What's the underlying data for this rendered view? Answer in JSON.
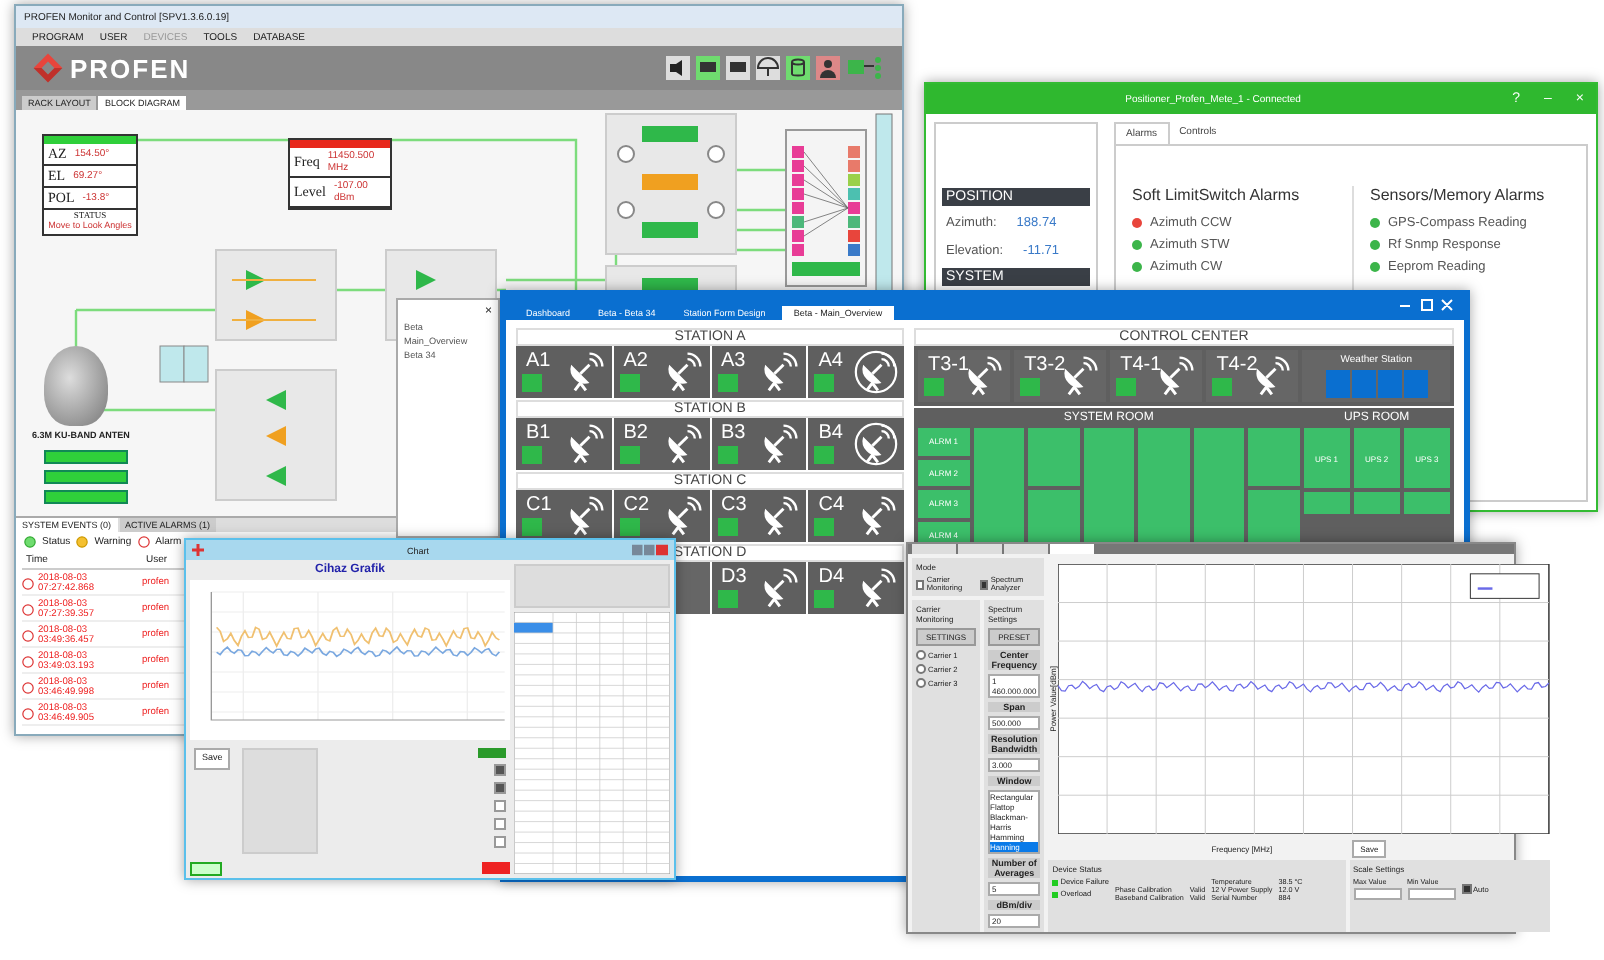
{
  "main_window": {
    "title": "PROFEN Monitor and Control [SPV1.3.6.0.19]",
    "menu": [
      {
        "label": "PROGRAM",
        "disabled": false
      },
      {
        "label": "USER",
        "disabled": false
      },
      {
        "label": "DEVICES",
        "disabled": true
      },
      {
        "label": "TOOLS",
        "disabled": false
      },
      {
        "label": "DATABASE",
        "disabled": false
      }
    ],
    "logo": "PROFEN",
    "tabs": [
      {
        "label": "RACK LAYOUT",
        "selected": false
      },
      {
        "label": "BLOCK DIAGRAM",
        "selected": true
      }
    ],
    "position_panel": {
      "rows": [
        {
          "label": "AZ",
          "value": "154.50°"
        },
        {
          "label": "EL",
          "value": "69.27°"
        },
        {
          "label": "POL",
          "value": "-13.8°"
        }
      ],
      "status_label": "STATUS",
      "status": "Move to Look Angles"
    },
    "receiver_panel": {
      "rows": [
        {
          "label": "Freq",
          "value": "11450.500 MHz"
        },
        {
          "label": "Level",
          "value": "-107.00 dBm"
        }
      ]
    },
    "antenna_label": "6.3M KU-BAND ANTEN",
    "events": {
      "tabs": [
        {
          "label": "SYSTEM EVENTS (0)",
          "selected": true
        },
        {
          "label": "ACTIVE ALARMS (1)",
          "selected": false
        }
      ],
      "legend": [
        "Status",
        "Warning",
        "Alarm"
      ],
      "columns": [
        "Time",
        "User"
      ],
      "rows": [
        {
          "time": "2018-08-03 07:27:42.868",
          "user": "profen"
        },
        {
          "time": "2018-08-03 07:27:39.357",
          "user": "profen"
        },
        {
          "time": "2018-08-03 03:49:36.457",
          "user": "profen"
        },
        {
          "time": "2018-08-03 03:49:03.193",
          "user": "profen"
        },
        {
          "time": "2018-08-03 03:46:49.998",
          "user": "profen"
        },
        {
          "time": "2018-08-03 03:46:49.905",
          "user": "profen"
        }
      ]
    }
  },
  "positioner_window": {
    "title": "Positioner_Profen_Mete_1 - Connected",
    "window_buttons": [
      "?",
      "–",
      "×"
    ],
    "position_heading": "POSITION",
    "readings": [
      {
        "label": "Azimuth:",
        "value": "188.74"
      },
      {
        "label": "Elevation:",
        "value": "-11.71"
      }
    ],
    "system_heading": "SYSTEM",
    "tabs": [
      {
        "label": "Alarms",
        "selected": true
      },
      {
        "label": "Controls",
        "selected": false
      }
    ],
    "alarm_groups": [
      {
        "title": "Soft LimitSwitch Alarms",
        "items": [
          {
            "label": "Azimuth CCW",
            "alarm": true
          },
          {
            "label": "Azimuth STW",
            "alarm": false
          },
          {
            "label": "Azimuth CW",
            "alarm": false
          }
        ]
      },
      {
        "title": "Sensors/Memory Alarms",
        "items": [
          {
            "label": "GPS-Compass Reading",
            "alarm": false
          },
          {
            "label": "Rf Snmp Response",
            "alarm": false
          },
          {
            "label": "Eeprom Reading",
            "alarm": false
          }
        ]
      }
    ]
  },
  "overview_window": {
    "close": "×",
    "tree": [
      "Beta",
      "Main_Overview",
      "Beta 34"
    ],
    "tabs": [
      {
        "label": "Dashboard",
        "selected": false
      },
      {
        "label": "Beta - Beta 34",
        "selected": false
      },
      {
        "label": "Station Form Design",
        "selected": false
      },
      {
        "label": "Beta - Main_Overview",
        "selected": true
      }
    ],
    "stations": [
      {
        "title": "STATION A",
        "tiles": [
          {
            "label": "A1",
            "kind": "dish"
          },
          {
            "label": "A2",
            "kind": "dish"
          },
          {
            "label": "A3",
            "kind": "dish"
          },
          {
            "label": "A4",
            "kind": "ring"
          }
        ]
      },
      {
        "title": "STATION B",
        "tiles": [
          {
            "label": "B1",
            "kind": "dish"
          },
          {
            "label": "B2",
            "kind": "dish"
          },
          {
            "label": "B3",
            "kind": "dish"
          },
          {
            "label": "B4",
            "kind": "ring"
          }
        ]
      },
      {
        "title": "STATION C",
        "tiles": [
          {
            "label": "C1",
            "kind": "dish"
          },
          {
            "label": "C2",
            "kind": "dish"
          },
          {
            "label": "C3",
            "kind": "dish"
          },
          {
            "label": "C4",
            "kind": "dish"
          }
        ]
      },
      {
        "title": "STATION D",
        "tiles": [
          {
            "kind": "hidden"
          },
          {
            "kind": "hidden"
          },
          {
            "label": "D3",
            "kind": "dish"
          },
          {
            "label": "D4",
            "kind": "dish"
          }
        ]
      }
    ],
    "control_center": {
      "title": "CONTROL CENTER",
      "terminals": [
        "T3-1",
        "T3-2",
        "T4-1",
        "T4-2"
      ],
      "weather_title": "Weather Station",
      "system_room": "SYSTEM ROOM",
      "alarms": [
        "ALRM 1",
        "ALRM 2",
        "ALRM 3",
        "ALRM 4"
      ],
      "ups_room": "UPS ROOM",
      "ups": [
        "UPS 1",
        "UPS 2",
        "UPS 3"
      ]
    }
  },
  "chart_window": {
    "title": "Chart",
    "heading": "Cihaz Grafik",
    "save": "Save",
    "checks": [
      {
        "checked": true
      },
      {
        "checked": true
      },
      {
        "checked": false
      },
      {
        "checked": false
      },
      {
        "checked": false
      }
    ]
  },
  "spectrum_window": {
    "tabs": [
      {
        "selected": false
      },
      {
        "selected": false
      },
      {
        "selected": false
      },
      {
        "selected": true
      }
    ],
    "mode_title": "Mode",
    "modes": [
      {
        "label": "Carrier Monitoring",
        "checked": false
      },
      {
        "label": "Spectrum Analyzer",
        "checked": true
      }
    ],
    "carrier_title": "Carrier Monitoring",
    "settings_title": "Spectrum Settings",
    "settings_button": "SETTINGS",
    "preset_button": "PRESET",
    "carriers": [
      {
        "label": "Carrier 1",
        "selected": false
      },
      {
        "label": "Carrier 2",
        "selected": false
      },
      {
        "label": "Carrier 3",
        "selected": false
      }
    ],
    "fields": [
      {
        "label": "Center Frequency",
        "value": "1 460.000.000"
      },
      {
        "label": "Span",
        "value": "500.000"
      },
      {
        "label": "Resolution Bandwidth",
        "value": "3.000"
      }
    ],
    "window_title": "Window",
    "windows": [
      {
        "label": "Rectangular",
        "selected": false
      },
      {
        "label": "Flattop",
        "selected": false
      },
      {
        "label": "Blackman-Harris",
        "selected": false
      },
      {
        "label": "Hamming",
        "selected": false
      },
      {
        "label": "Hanning",
        "selected": true
      }
    ],
    "fields2": [
      {
        "label": "Number of Averages",
        "value": "5"
      },
      {
        "label": "dBm/div",
        "value": "20"
      }
    ],
    "xlabel": "Frequency [MHz]",
    "ylabel": "Power Value[dBm]",
    "save": "Save",
    "device_status": {
      "title": "Device Status",
      "flags": [
        {
          "label": "Device Failure",
          "on": true
        },
        {
          "label": "Overload",
          "on": true
        }
      ],
      "cells": [
        [
          "",
          "",
          "Temperature",
          "38.5 °C"
        ],
        [
          "Phase Calibration",
          "Valid",
          "12 V Power Supply",
          "12.0 V"
        ],
        [
          "Baseband Calibration",
          "Valid",
          "Serial Number",
          "884"
        ]
      ]
    },
    "scale": {
      "title": "Scale Settings",
      "columns": [
        "Max Value",
        "Min Value"
      ],
      "auto": {
        "label": "Auto",
        "checked": true
      }
    }
  }
}
